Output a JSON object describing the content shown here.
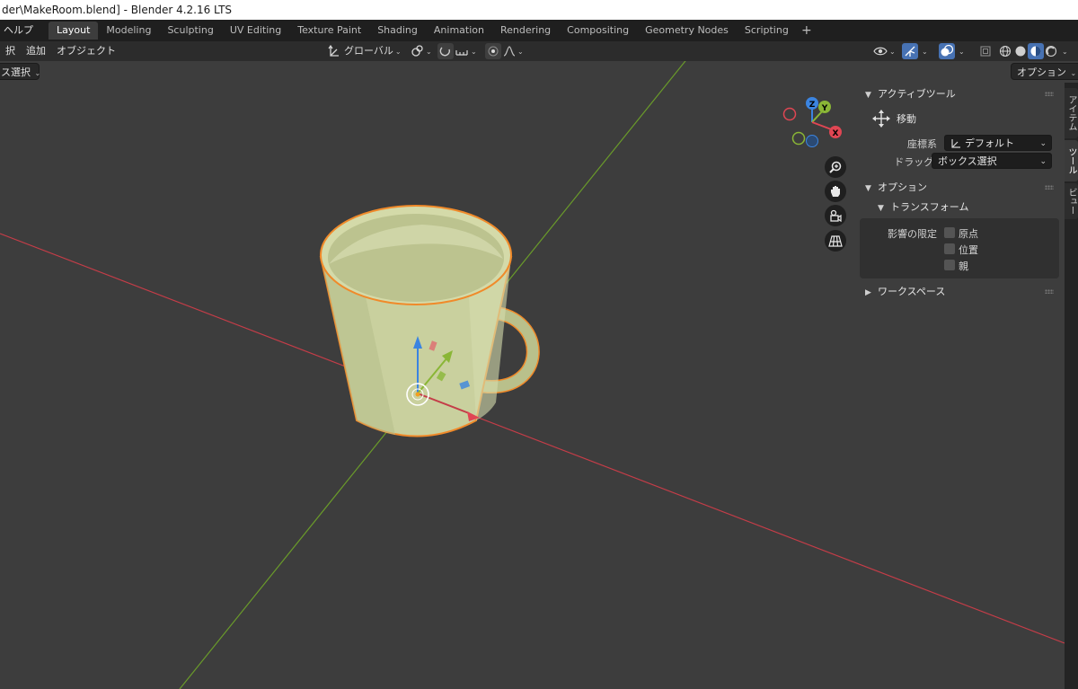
{
  "window": {
    "title": "der\\MakeRoom.blend] - Blender 4.2.16 LTS"
  },
  "topbar": {
    "help_menu": "ヘルプ",
    "tabs": [
      "Layout",
      "Modeling",
      "Sculpting",
      "UV Editing",
      "Texture Paint",
      "Shading",
      "Animation",
      "Rendering",
      "Compositing",
      "Geometry Nodes",
      "Scripting"
    ],
    "active_tab": "Layout",
    "add_tab_symbol": "+"
  },
  "view_header": {
    "menus": [
      "択",
      "追加",
      "オブジェクト"
    ],
    "transform_orientation": "グローバル",
    "options_button": "オプション"
  },
  "row2": {
    "select_mode": "ス選択"
  },
  "npanel": {
    "active_tool": {
      "header": "アクティブツール",
      "tool_name": "移動",
      "coord_label": "座標系",
      "coord_value": "デフォルト",
      "drag_label": "ドラッグ:",
      "drag_value": "ボックス選択"
    },
    "options": {
      "header": "オプション",
      "transform_header": "トランスフォーム",
      "affect_only_label": "影響の限定",
      "checkboxes": [
        {
          "label": "原点",
          "checked": false
        },
        {
          "label": "位置",
          "checked": false
        },
        {
          "label": "親",
          "checked": false
        }
      ]
    },
    "workspace": {
      "header": "ワークスペース"
    }
  },
  "sidebar_tabs": [
    "アイテム",
    "ツール",
    "ビュー"
  ],
  "active_sidebar_tab": "ツール",
  "gizmo": {
    "x_label": "X",
    "y_label": "Y",
    "z_label": "Z",
    "x_color": "#e04653",
    "y_color": "#8ab636",
    "z_color": "#3b84e0"
  },
  "colors": {
    "x_axis_line": "#c43d48",
    "y_axis_line": "#6a9b2a",
    "mug_body": "#c8cf9e",
    "selection_outline": "#f08a2a"
  }
}
